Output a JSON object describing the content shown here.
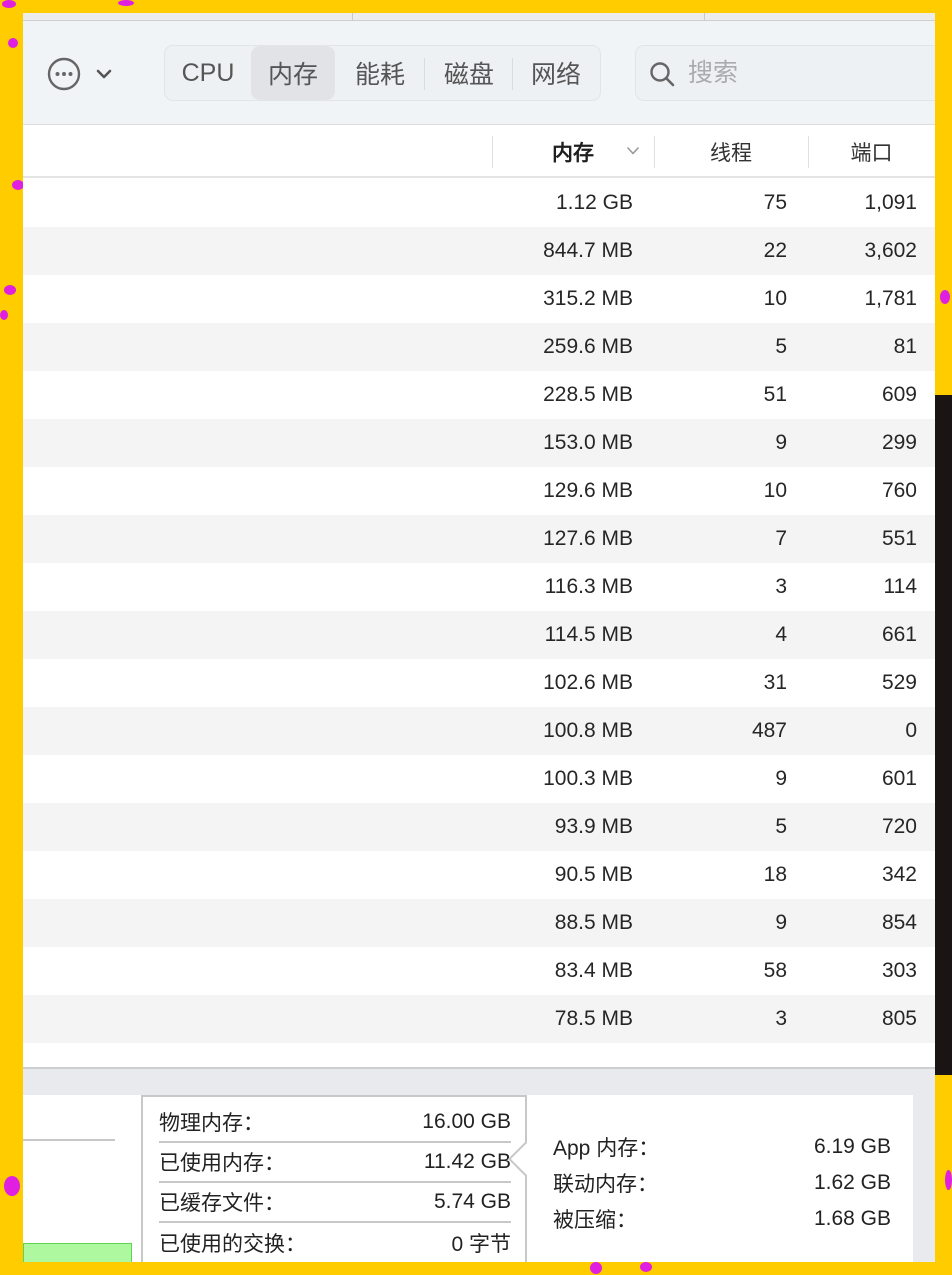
{
  "toolbar": {
    "tabs": [
      {
        "label": "CPU",
        "active": false
      },
      {
        "label": "内存",
        "active": true
      },
      {
        "label": "能耗",
        "active": false
      },
      {
        "label": "磁盘",
        "active": false
      },
      {
        "label": "网络",
        "active": false
      }
    ],
    "search_placeholder": "搜索",
    "search_value": ""
  },
  "table": {
    "columns": [
      {
        "label": "内存",
        "sorted": "descending"
      },
      {
        "label": "线程"
      },
      {
        "label": "端口"
      }
    ],
    "rows": [
      {
        "memory": "1.12 GB",
        "threads": "75",
        "ports": "1,091"
      },
      {
        "memory": "844.7 MB",
        "threads": "22",
        "ports": "3,602"
      },
      {
        "memory": "315.2 MB",
        "threads": "10",
        "ports": "1,781"
      },
      {
        "memory": "259.6 MB",
        "threads": "5",
        "ports": "81"
      },
      {
        "memory": "228.5 MB",
        "threads": "51",
        "ports": "609"
      },
      {
        "memory": "153.0 MB",
        "threads": "9",
        "ports": "299"
      },
      {
        "memory": "129.6 MB",
        "threads": "10",
        "ports": "760"
      },
      {
        "memory": "127.6 MB",
        "threads": "7",
        "ports": "551"
      },
      {
        "memory": "116.3 MB",
        "threads": "3",
        "ports": "114"
      },
      {
        "memory": "114.5 MB",
        "threads": "4",
        "ports": "661"
      },
      {
        "memory": "102.6 MB",
        "threads": "31",
        "ports": "529"
      },
      {
        "memory": "100.8 MB",
        "threads": "487",
        "ports": "0"
      },
      {
        "memory": "100.3 MB",
        "threads": "9",
        "ports": "601"
      },
      {
        "memory": "93.9 MB",
        "threads": "5",
        "ports": "720"
      },
      {
        "memory": "90.5 MB",
        "threads": "18",
        "ports": "342"
      },
      {
        "memory": "88.5 MB",
        "threads": "9",
        "ports": "854"
      },
      {
        "memory": "83.4 MB",
        "threads": "58",
        "ports": "303"
      },
      {
        "memory": "78.5 MB",
        "threads": "3",
        "ports": "805"
      }
    ]
  },
  "footer": {
    "stats": [
      {
        "label": "物理内存：",
        "value": "16.00 GB"
      },
      {
        "label": "已使用内存：",
        "value": "11.42 GB"
      },
      {
        "label": "已缓存文件：",
        "value": "5.74 GB"
      },
      {
        "label": "已使用的交换：",
        "value": "0 字节"
      }
    ],
    "breakdown": [
      {
        "label": "App 内存：",
        "value": "6.19 GB"
      },
      {
        "label": "联动内存：",
        "value": "1.62 GB"
      },
      {
        "label": "被压缩：",
        "value": "1.68 GB"
      }
    ]
  },
  "colors": {
    "background": "#ffcc00",
    "pressure_bar": "#aef8a0",
    "pressure_bar_border": "#5fd352"
  }
}
